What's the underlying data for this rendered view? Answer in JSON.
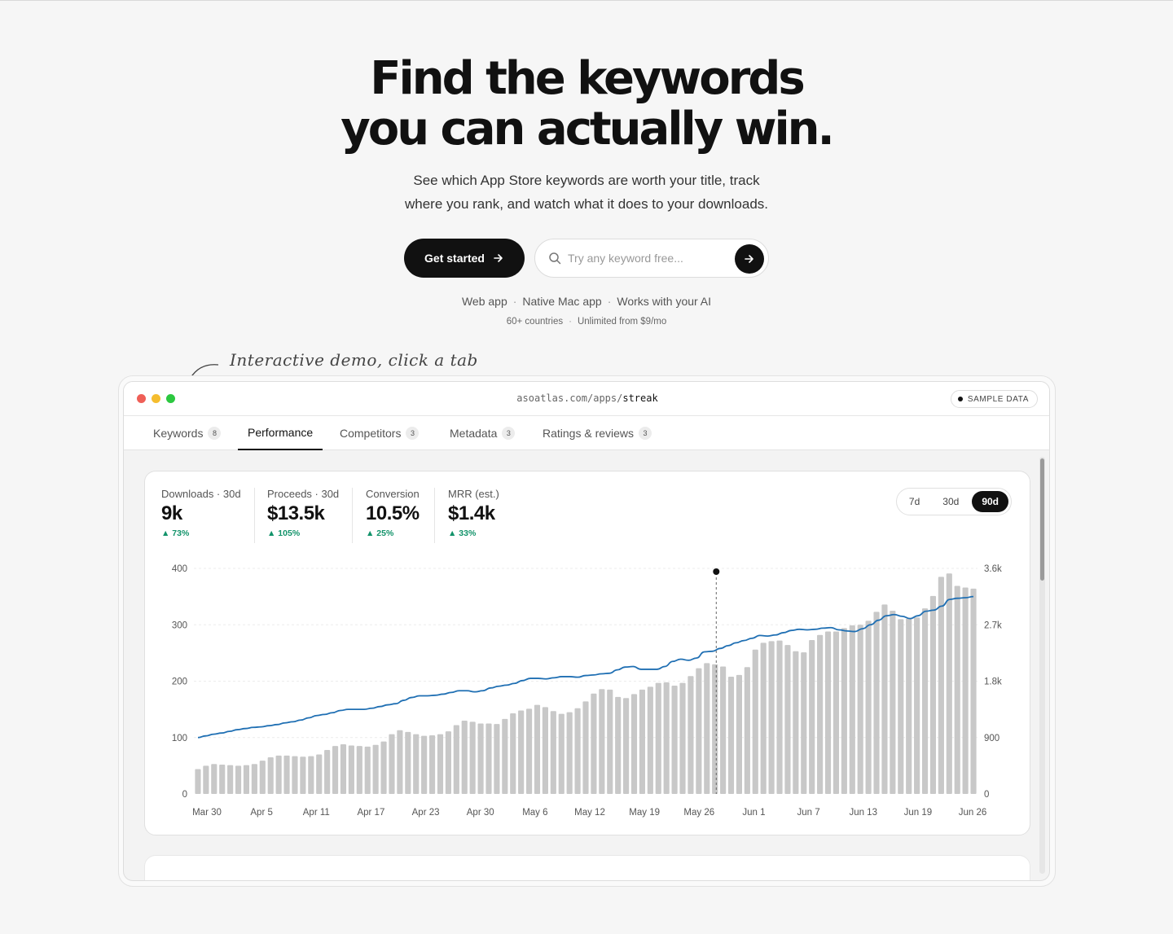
{
  "hero": {
    "title_line1": "Find the keywords",
    "title_line2": "you can actually win.",
    "sub_line1": "See which App Store keywords are worth your title, track",
    "sub_line2": "where you rank, and watch what it does to your downloads."
  },
  "cta": {
    "label": "Get started",
    "icon": "arrow-right-icon"
  },
  "search": {
    "placeholder": "Try any keyword free...",
    "icon": "search-icon",
    "submit_icon": "arrow-right-icon"
  },
  "platforms": [
    "Web app",
    "Native Mac app",
    "Works with your AI"
  ],
  "meta": [
    "60+ countries",
    "Unlimited from $9/mo"
  ],
  "annotation": "Interactive demo, click a tab",
  "window": {
    "url_prefix": "asoatlas.com/apps/",
    "url_path": "streak",
    "sample_badge": "SAMPLE DATA"
  },
  "tabs": [
    {
      "label": "Keywords",
      "count": "8",
      "active": false
    },
    {
      "label": "Performance",
      "count": "",
      "active": true
    },
    {
      "label": "Competitors",
      "count": "3",
      "active": false
    },
    {
      "label": "Metadata",
      "count": "3",
      "active": false
    },
    {
      "label": "Ratings & reviews",
      "count": "3",
      "active": false
    }
  ],
  "kpis": [
    {
      "label": "Downloads · 30d",
      "value": "9k",
      "delta": "▲ 73%"
    },
    {
      "label": "Proceeds · 30d",
      "value": "$13.5k",
      "delta": "▲ 105%"
    },
    {
      "label": "Conversion",
      "value": "10.5%",
      "delta": "▲ 25%"
    },
    {
      "label": "MRR (est.)",
      "value": "$1.4k",
      "delta": "▲ 33%"
    }
  ],
  "range": {
    "options": [
      "7d",
      "30d",
      "90d"
    ],
    "selected": "90d"
  },
  "colors": {
    "bar": "#c8c8c8",
    "line": "#1f6fb3",
    "delta": "#12936a",
    "dark": "#111111"
  },
  "chart_data": {
    "type": "bar",
    "left_axis": {
      "ticks": [
        "0",
        "100",
        "200",
        "300",
        "400"
      ],
      "ylim": [
        0,
        400
      ]
    },
    "right_axis": {
      "ticks": [
        "0",
        "900",
        "1.8k",
        "2.7k",
        "3.6k"
      ],
      "ylim": [
        0,
        3600
      ]
    },
    "x_tick_labels": [
      "Mar 30",
      "Apr 5",
      "Apr 11",
      "Apr 17",
      "Apr 23",
      "Apr 30",
      "May 6",
      "May 12",
      "May 19",
      "May 26",
      "Jun 1",
      "Jun 7",
      "Jun 13",
      "Jun 19",
      "Jun 26"
    ],
    "bar_values": [
      44,
      50,
      53,
      52,
      51,
      50,
      51,
      53,
      59,
      65,
      68,
      68,
      67,
      66,
      67,
      70,
      78,
      85,
      88,
      86,
      85,
      84,
      87,
      93,
      106,
      113,
      110,
      106,
      103,
      104,
      106,
      111,
      122,
      130,
      128,
      125,
      125,
      124,
      133,
      143,
      148,
      151,
      158,
      154,
      147,
      142,
      145,
      152,
      164,
      178,
      186,
      185,
      172,
      170,
      177,
      185,
      190,
      197,
      198,
      192,
      197,
      209,
      223,
      232,
      230,
      226,
      208,
      211,
      225,
      256,
      268,
      271,
      272,
      264,
      253,
      251,
      273,
      282,
      288,
      288,
      294,
      299,
      300,
      307,
      323,
      336,
      325,
      310,
      311,
      313,
      329,
      351,
      385,
      391,
      369,
      366,
      364
    ],
    "line_values": [
      100,
      103,
      106,
      108,
      111,
      114,
      116,
      118,
      119,
      121,
      123,
      126,
      128,
      131,
      135,
      139,
      141,
      144,
      148,
      150,
      150,
      150,
      152,
      155,
      158,
      160,
      166,
      171,
      174,
      174,
      175,
      177,
      180,
      183,
      183,
      181,
      183,
      188,
      191,
      193,
      196,
      201,
      205,
      205,
      204,
      206,
      208,
      208,
      207,
      210,
      211,
      213,
      214,
      220,
      225,
      226,
      221,
      221,
      221,
      226,
      235,
      239,
      237,
      241,
      252,
      253,
      258,
      263,
      268,
      272,
      276,
      281,
      280,
      282,
      286,
      290,
      292,
      291,
      292,
      294,
      295,
      291,
      289,
      288,
      293,
      300,
      308,
      316,
      318,
      315,
      311,
      316,
      324,
      326,
      333,
      345,
      347,
      348,
      350
    ],
    "hover_marker_at": "May 26"
  },
  "scrollbar": {
    "position": 0.0
  }
}
